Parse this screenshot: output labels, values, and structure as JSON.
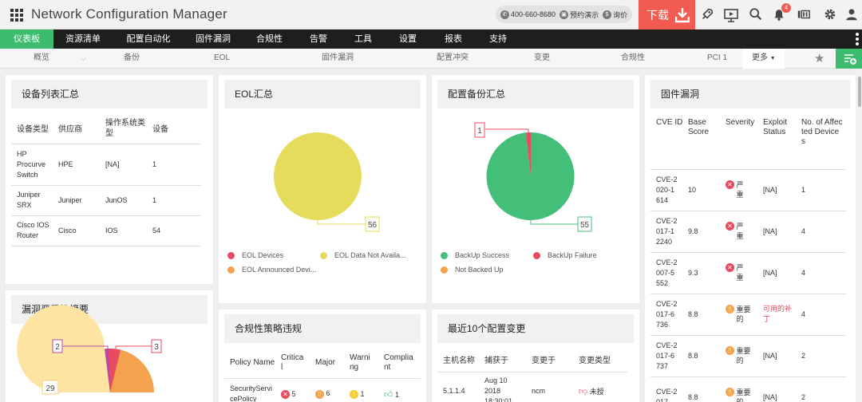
{
  "header": {
    "title": "Network Configuration Manager",
    "phone": "400-660-8680",
    "demo": "预约演示",
    "quote": "询价",
    "download": "下载",
    "notification_count": "4"
  },
  "nav": [
    "仪表板",
    "资源清单",
    "配置自动化",
    "固件漏洞",
    "合规性",
    "告警",
    "工具",
    "设置",
    "报表",
    "支持"
  ],
  "subnav": [
    "概览",
    "备份",
    "EOL",
    "固件漏洞",
    "配置冲突",
    "变更",
    "合规性",
    "PCI 1"
  ],
  "subnav_more": "更多",
  "device_summary": {
    "title": "设备列表汇总",
    "columns": [
      "设备类型",
      "供应商",
      "操作系统类型",
      "设备"
    ],
    "rows": [
      [
        "HP Procurve Switch",
        "HPE",
        "[NA]",
        "1"
      ],
      [
        "Juniper SRX",
        "Juniper",
        "JunOS",
        "1"
      ],
      [
        "Cisco IOS Router",
        "Cisco",
        "IOS",
        "54"
      ]
    ]
  },
  "eol_summary": {
    "title": "EOL汇总",
    "value_label": "56",
    "legend": [
      "EOL Devices",
      "EOL Data Not Availa...",
      "EOL Announced Devi..."
    ]
  },
  "backup_summary": {
    "title": "配置备份汇总",
    "label_failure": "1",
    "label_success": "55",
    "legend": [
      "BackUp Success",
      "BackUp Failure",
      "Not Backed Up"
    ]
  },
  "firmware_vuln": {
    "title": "固件漏洞",
    "columns": [
      "CVE ID",
      "Base Score",
      "Severity",
      "Exploit Status",
      "No. of Affected Devices"
    ],
    "rows": [
      {
        "cve": "CVE-2020-1614",
        "score": "10",
        "sev": "严重",
        "sev_type": "critical",
        "exploit": "[NA]",
        "count": "1"
      },
      {
        "cve": "CVE-2017-12240",
        "score": "9.8",
        "sev": "严重",
        "sev_type": "critical",
        "exploit": "[NA]",
        "count": "4"
      },
      {
        "cve": "CVE-2007-5552",
        "score": "9.3",
        "sev": "严重",
        "sev_type": "critical",
        "exploit": "[NA]",
        "count": "4"
      },
      {
        "cve": "CVE-2017-6736",
        "score": "8.8",
        "sev": "重要的",
        "sev_type": "important",
        "exploit": "可用的补丁",
        "count": "4"
      },
      {
        "cve": "CVE-2017-6737",
        "score": "8.8",
        "sev": "重要的",
        "sev_type": "important",
        "exploit": "[NA]",
        "count": "2"
      },
      {
        "cve": "CVE-2017-",
        "score": "8.8",
        "sev": "重要的",
        "sev_type": "important",
        "exploit": "[NA]",
        "count": "2"
      }
    ]
  },
  "vuln_severity": {
    "title": "漏洞严重性摘要",
    "labels": [
      "2",
      "3",
      "29"
    ]
  },
  "compliance": {
    "title": "合规性策略违规",
    "columns": [
      "Policy Name",
      "Critical",
      "Major",
      "Warning",
      "Compliant"
    ],
    "rows": [
      {
        "name": "SecurityServicePolicy",
        "critical": "5",
        "major": "6",
        "warning": "1",
        "compliant": "1"
      }
    ]
  },
  "recent_changes": {
    "title": "最近10个配置变更",
    "columns": [
      "主机名称",
      "捕获于",
      "变更于",
      "变更类型"
    ],
    "rows": [
      {
        "host": "5.1.1.4",
        "captured": "Aug 10 2018 18:30:01",
        "by": "ncm",
        "type": "未授"
      }
    ]
  },
  "colors": {
    "accent_green": "#3dbb6e",
    "download_red": "#f25b51",
    "eol_yellow": "#e5dc5b",
    "eol_red": "#e84a5f",
    "eol_orange": "#f4a24d",
    "backup_green": "#43bf79",
    "backup_red": "#e84a5f",
    "backup_orange": "#f4a24d"
  }
}
